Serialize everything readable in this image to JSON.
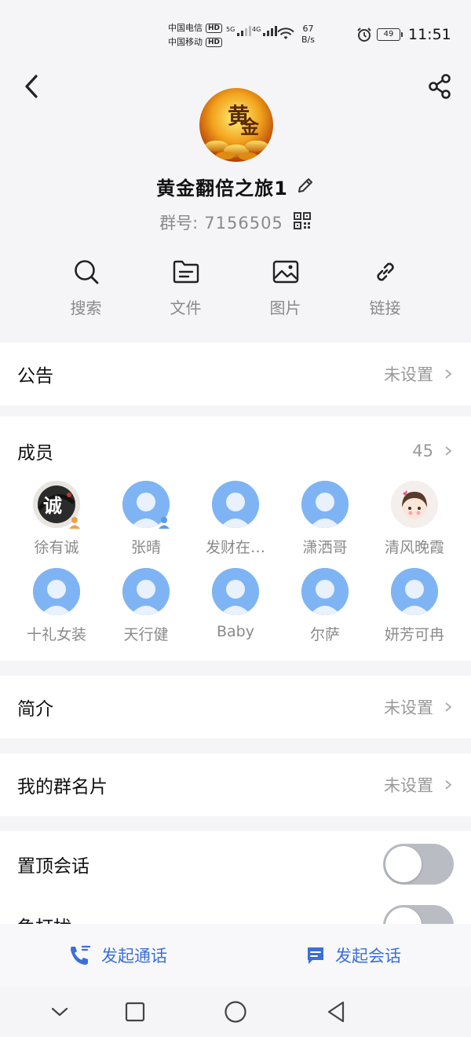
{
  "status_bar": {
    "carrier1": "中国电信",
    "carrier2": "中国移动",
    "hd": "HD",
    "net1": "5G",
    "net2": "4G",
    "speed_value": "67",
    "speed_unit": "B/s",
    "battery": "49",
    "time": "11:51"
  },
  "group": {
    "name": "黄金翻倍之旅1",
    "id_label": "群号:",
    "id_value": "7156505"
  },
  "quick_actions": [
    {
      "label": "搜索",
      "icon": "search-icon"
    },
    {
      "label": "文件",
      "icon": "file-icon"
    },
    {
      "label": "图片",
      "icon": "image-icon"
    },
    {
      "label": "链接",
      "icon": "link-icon"
    }
  ],
  "announcement": {
    "title": "公告",
    "value": "未设置"
  },
  "members": {
    "title": "成员",
    "count": "45",
    "list": [
      {
        "name": "徐有诚",
        "avatar": "custom-calligraphy",
        "badge": "owner"
      },
      {
        "name": "张晴",
        "avatar": "default",
        "badge": "admin"
      },
      {
        "name": "发财在…",
        "avatar": "default",
        "badge": ""
      },
      {
        "name": "潇洒哥",
        "avatar": "default",
        "badge": ""
      },
      {
        "name": "清风晚霞",
        "avatar": "custom-girl",
        "badge": ""
      },
      {
        "name": "十礼女装",
        "avatar": "default",
        "badge": ""
      },
      {
        "name": "天行健",
        "avatar": "default",
        "badge": ""
      },
      {
        "name": "Baby",
        "avatar": "default",
        "badge": ""
      },
      {
        "name": "尔萨",
        "avatar": "default",
        "badge": ""
      },
      {
        "name": "妍芳可冉",
        "avatar": "default",
        "badge": ""
      }
    ]
  },
  "intro": {
    "title": "简介",
    "value": "未设置"
  },
  "my_card": {
    "title": "我的群名片",
    "value": "未设置"
  },
  "pin_chat": {
    "title": "置顶会话",
    "enabled": false
  },
  "dnd": {
    "title": "免打扰",
    "enabled": false
  },
  "bottom": {
    "call_label": "发起通话",
    "chat_label": "发起会话"
  },
  "colors": {
    "accent": "#3a6fd8",
    "avatar_default": "#7fb4f4",
    "owner_badge": "#f0a04a",
    "admin_badge": "#5a9be8",
    "toggle_off": "#b9bcc3"
  }
}
